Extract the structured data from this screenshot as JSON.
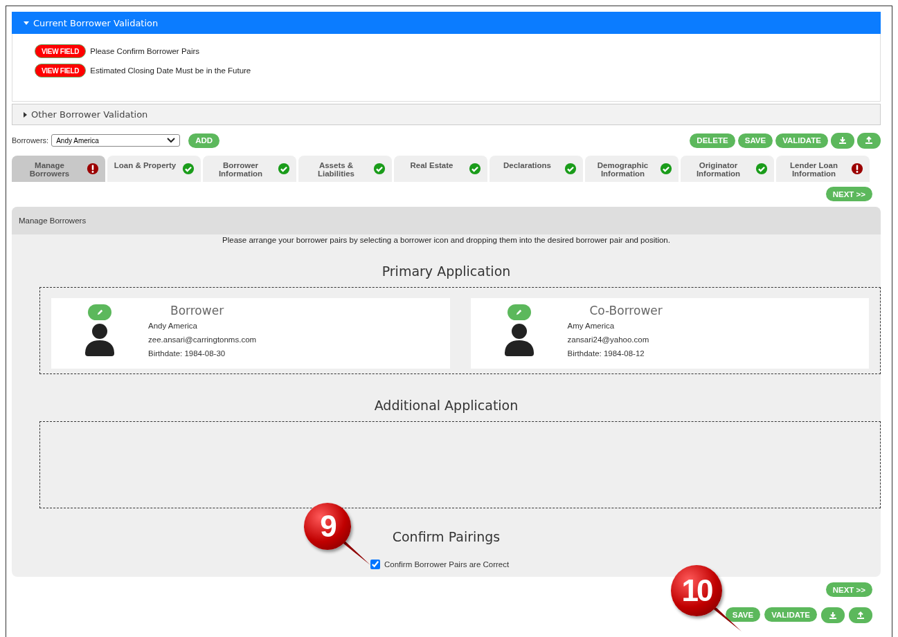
{
  "current_validation": {
    "title": "Current Borrower Validation",
    "expanded": true,
    "items": [
      {
        "button": "VIEW FIELD",
        "message": "Please Confirm Borrower Pairs"
      },
      {
        "button": "VIEW FIELD",
        "message": "Estimated Closing Date Must be in the Future"
      }
    ]
  },
  "other_validation": {
    "title": "Other Borrower Validation",
    "expanded": false
  },
  "borrowers": {
    "label": "Borrowers:",
    "value": "Andy America",
    "add": "ADD"
  },
  "top_actions": [
    "DELETE",
    "SAVE",
    "VALIDATE"
  ],
  "tabs": [
    {
      "label": "Manage Borrowers",
      "complete": false,
      "selected": true
    },
    {
      "label": "Loan & Property",
      "complete": true,
      "selected": false
    },
    {
      "label": "Borrower Information",
      "complete": true,
      "selected": false
    },
    {
      "label": "Assets & Liabilities",
      "complete": true,
      "selected": false
    },
    {
      "label": "Real Estate",
      "complete": true,
      "selected": false
    },
    {
      "label": "Declarations",
      "complete": true,
      "selected": false
    },
    {
      "label": "Demographic Information",
      "complete": true,
      "selected": false
    },
    {
      "label": "Originator Information",
      "complete": true,
      "selected": false
    },
    {
      "label": "Lender Loan Information",
      "complete": false,
      "selected": false
    }
  ],
  "next": "NEXT >>",
  "panel": {
    "title": "Manage Borrowers",
    "instruction": "Please arrange your borrower pairs by selecting a borrower icon and dropping them into the desired borrower pair and position.",
    "primary_title": "Primary Application",
    "primary": [
      {
        "role": "Borrower",
        "name": "Andy America",
        "email": "zee.ansari@carringtonms.com",
        "birthdate": "Birthdate: 1984-08-30"
      },
      {
        "role": "Co-Borrower",
        "name": "Amy America",
        "email": "zansari24@yahoo.com",
        "birthdate": "Birthdate: 1984-08-12"
      }
    ],
    "additional_title": "Additional Application",
    "confirm_title": "Confirm Pairings",
    "confirm": {
      "label": "Confirm Borrower Pairs are Correct",
      "checked": true
    }
  },
  "bottom_next": "NEXT >>",
  "bottom_actions": [
    "SAVE",
    "VALIDATE"
  ],
  "callouts": [
    {
      "text": "9"
    },
    {
      "text": "10"
    }
  ]
}
